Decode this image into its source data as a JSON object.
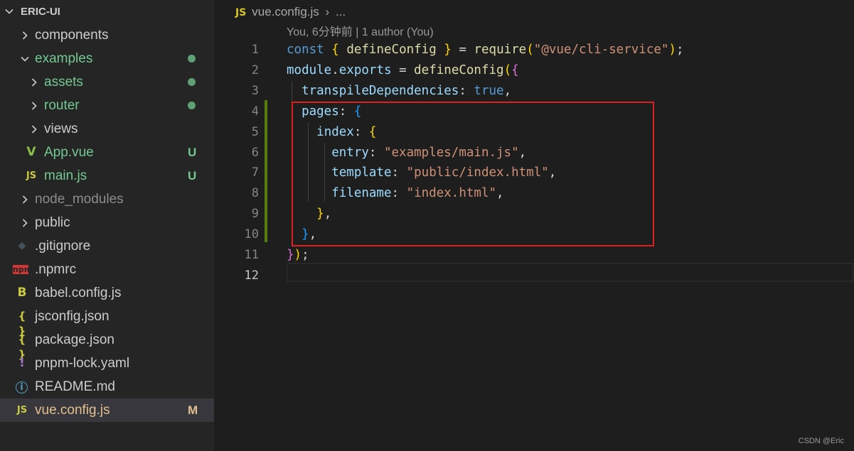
{
  "explorer": {
    "root": "ERIC-UI",
    "items": [
      {
        "label": "components",
        "indent": 0,
        "chevron": "right",
        "icon": "none",
        "color": "#cccccc",
        "status": ""
      },
      {
        "label": "examples",
        "indent": 0,
        "chevron": "down",
        "icon": "none",
        "color": "#73c991",
        "status": "dot"
      },
      {
        "label": "assets",
        "indent": 1,
        "chevron": "right",
        "icon": "none",
        "color": "#73c991",
        "status": "dot"
      },
      {
        "label": "router",
        "indent": 1,
        "chevron": "right",
        "icon": "none",
        "color": "#73c991",
        "status": "dot"
      },
      {
        "label": "views",
        "indent": 1,
        "chevron": "right",
        "icon": "none",
        "color": "#cccccc",
        "status": ""
      },
      {
        "label": "App.vue",
        "indent": 1,
        "chevron": "none",
        "icon": "vue",
        "color": "#73c991",
        "status": "U"
      },
      {
        "label": "main.js",
        "indent": 1,
        "chevron": "none",
        "icon": "js",
        "color": "#73c991",
        "status": "U"
      },
      {
        "label": "node_modules",
        "indent": 0,
        "chevron": "right",
        "icon": "none",
        "color": "#8c8c8c",
        "status": ""
      },
      {
        "label": "public",
        "indent": 0,
        "chevron": "right",
        "icon": "none",
        "color": "#cccccc",
        "status": ""
      },
      {
        "label": ".gitignore",
        "indent": 0,
        "chevron": "none",
        "icon": "git",
        "color": "#cccccc",
        "status": ""
      },
      {
        "label": ".npmrc",
        "indent": 0,
        "chevron": "none",
        "icon": "npm",
        "color": "#cccccc",
        "status": ""
      },
      {
        "label": "babel.config.js",
        "indent": 0,
        "chevron": "none",
        "icon": "babel",
        "color": "#cccccc",
        "status": ""
      },
      {
        "label": "jsconfig.json",
        "indent": 0,
        "chevron": "none",
        "icon": "json",
        "color": "#cccccc",
        "status": ""
      },
      {
        "label": "package.json",
        "indent": 0,
        "chevron": "none",
        "icon": "json",
        "color": "#cccccc",
        "status": ""
      },
      {
        "label": "pnpm-lock.yaml",
        "indent": 0,
        "chevron": "none",
        "icon": "yaml",
        "color": "#cccccc",
        "status": ""
      },
      {
        "label": "README.md",
        "indent": 0,
        "chevron": "none",
        "icon": "info",
        "color": "#cccccc",
        "status": ""
      },
      {
        "label": "vue.config.js",
        "indent": 0,
        "chevron": "none",
        "icon": "js",
        "color": "#e2c08d",
        "status": "M",
        "selected": true
      }
    ]
  },
  "icon_glyphs": {
    "js": "JS",
    "json": "{ }",
    "yaml": "!",
    "babel": "B",
    "npm": "npm",
    "git": "◆",
    "info": "i",
    "vue": "V"
  },
  "icon_colors": {
    "js": "#cbcb41",
    "json": "#cbcb41",
    "yaml": "#a074c4",
    "babel": "#cbcb41",
    "npm": "#cb3837",
    "git": "#41535b",
    "info": "#519aba",
    "vue": "#8dc149"
  },
  "status_colors": {
    "U": "#73c991",
    "M": "#e2c08d"
  },
  "breadcrumb": {
    "file_icon": "JS",
    "file": "vue.config.js",
    "separator": "›",
    "more": "..."
  },
  "codelens": "You, 6分钟前 | 1 author (You)",
  "active_line": 12,
  "lines": [
    {
      "n": 1,
      "tokens": [
        [
          "const",
          "kw"
        ],
        [
          " ",
          "p"
        ],
        [
          "{",
          "b1"
        ],
        [
          " ",
          "p"
        ],
        [
          "defineConfig",
          "fn"
        ],
        [
          " ",
          "p"
        ],
        [
          "}",
          "b1"
        ],
        [
          " = ",
          "p"
        ],
        [
          "require",
          "fn"
        ],
        [
          "(",
          "b1"
        ],
        [
          "\"@vue/cli-service\"",
          "str"
        ],
        [
          ")",
          "b1"
        ],
        [
          ";",
          "p"
        ]
      ]
    },
    {
      "n": 2,
      "tokens": [
        [
          "module",
          "var"
        ],
        [
          ".",
          "p"
        ],
        [
          "exports",
          "var"
        ],
        [
          " = ",
          "p"
        ],
        [
          "defineConfig",
          "fn"
        ],
        [
          "(",
          "b1"
        ],
        [
          "{",
          "b2"
        ]
      ]
    },
    {
      "n": 3,
      "tokens": [
        [
          "  ",
          "p"
        ],
        [
          "transpileDependencies",
          "var"
        ],
        [
          ": ",
          "p"
        ],
        [
          "true",
          "kw"
        ],
        [
          ",",
          "p"
        ]
      ]
    },
    {
      "n": 4,
      "tokens": [
        [
          "  ",
          "p"
        ],
        [
          "pages",
          "var"
        ],
        [
          ": ",
          "p"
        ],
        [
          "{",
          "b3"
        ]
      ]
    },
    {
      "n": 5,
      "tokens": [
        [
          "    ",
          "p"
        ],
        [
          "index",
          "var"
        ],
        [
          ": ",
          "p"
        ],
        [
          "{",
          "b1"
        ]
      ]
    },
    {
      "n": 6,
      "tokens": [
        [
          "      ",
          "p"
        ],
        [
          "entry",
          "var"
        ],
        [
          ": ",
          "p"
        ],
        [
          "\"examples/main.js\"",
          "str"
        ],
        [
          ",",
          "p"
        ]
      ]
    },
    {
      "n": 7,
      "tokens": [
        [
          "      ",
          "p"
        ],
        [
          "template",
          "var"
        ],
        [
          ": ",
          "p"
        ],
        [
          "\"public/index.html\"",
          "str"
        ],
        [
          ",",
          "p"
        ]
      ]
    },
    {
      "n": 8,
      "tokens": [
        [
          "      ",
          "p"
        ],
        [
          "filename",
          "var"
        ],
        [
          ": ",
          "p"
        ],
        [
          "\"index.html\"",
          "str"
        ],
        [
          ",",
          "p"
        ]
      ]
    },
    {
      "n": 9,
      "tokens": [
        [
          "    ",
          "p"
        ],
        [
          "}",
          "b1"
        ],
        [
          ",",
          "p"
        ]
      ]
    },
    {
      "n": 10,
      "tokens": [
        [
          "  ",
          "p"
        ],
        [
          "}",
          "b3"
        ],
        [
          ",",
          "p"
        ]
      ]
    },
    {
      "n": 11,
      "tokens": [
        [
          "}",
          "b2"
        ],
        [
          ")",
          "b1"
        ],
        [
          ";",
          "p"
        ]
      ]
    },
    {
      "n": 12,
      "tokens": []
    }
  ],
  "watermark": "CSDN @Eric"
}
